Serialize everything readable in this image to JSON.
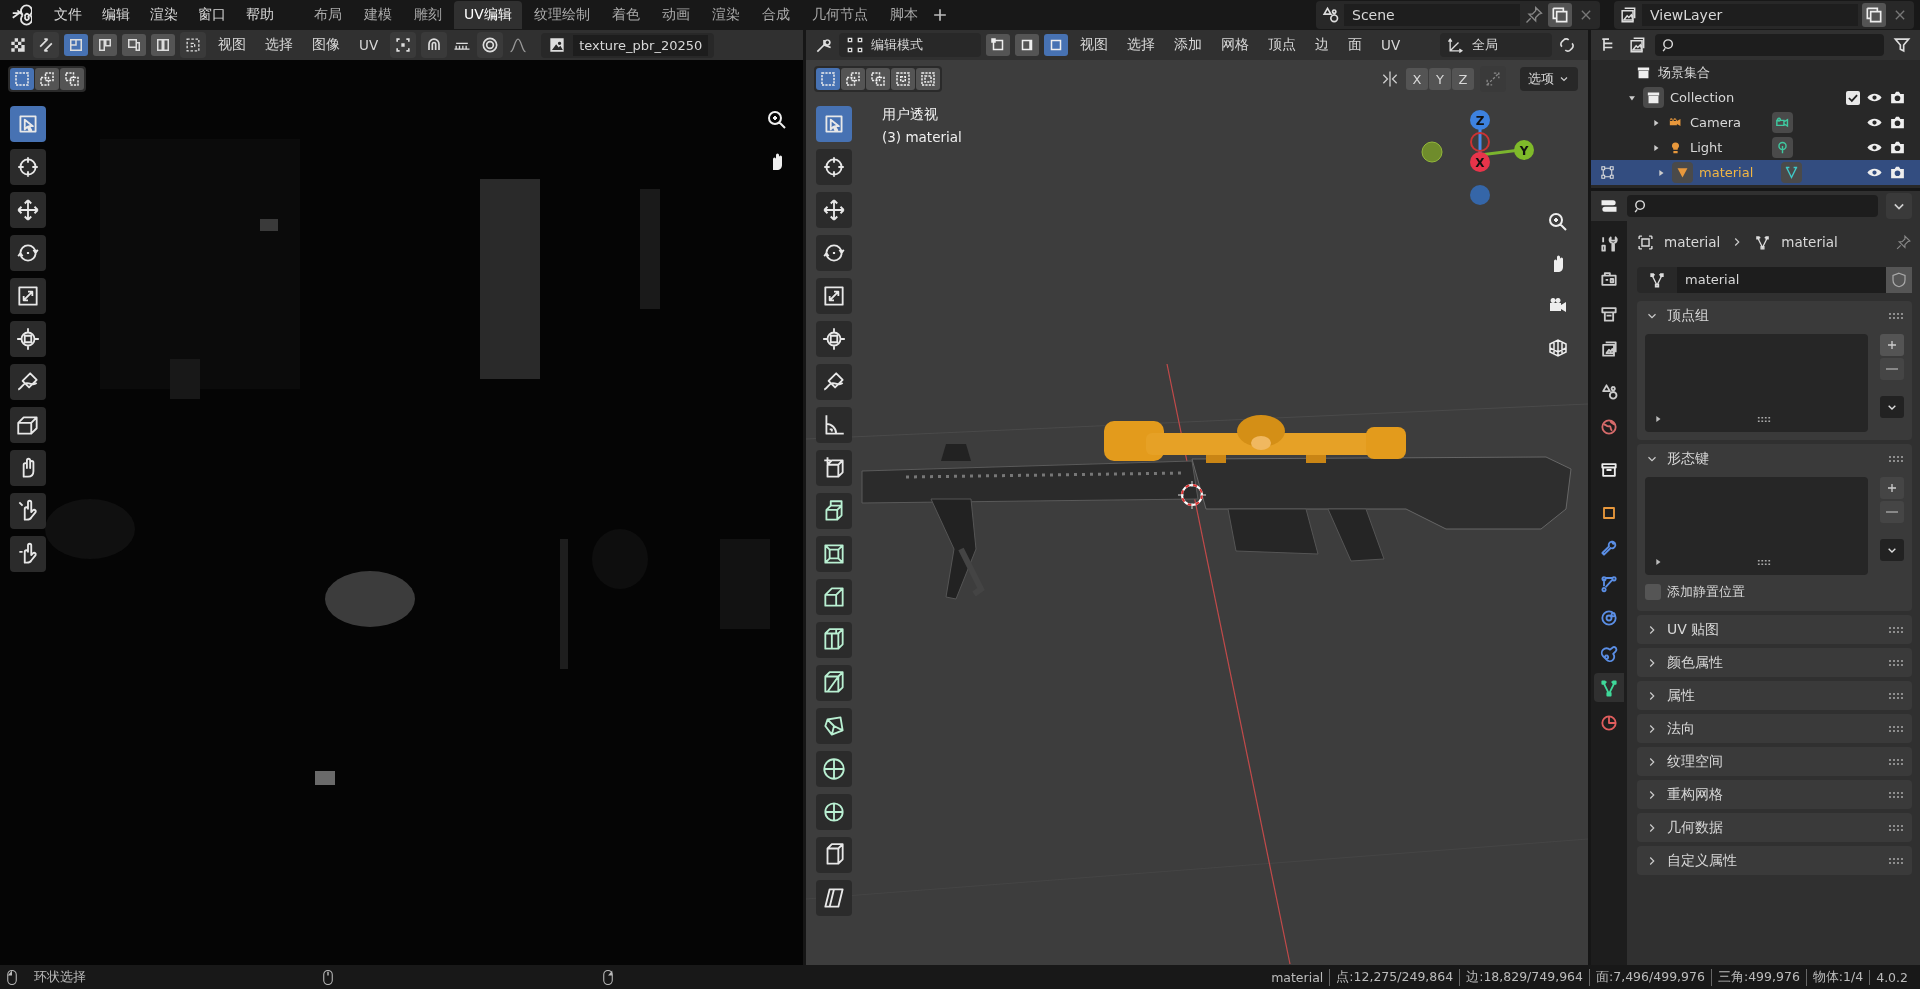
{
  "menu": [
    "文件",
    "编辑",
    "渲染",
    "窗口",
    "帮助"
  ],
  "workspaces": [
    {
      "label": "布局",
      "selected": false
    },
    {
      "label": "建模",
      "selected": false
    },
    {
      "label": "雕刻",
      "selected": false
    },
    {
      "label": "UV编辑",
      "selected": true
    },
    {
      "label": "纹理绘制",
      "selected": false
    },
    {
      "label": "着色",
      "selected": false
    },
    {
      "label": "动画",
      "selected": false
    },
    {
      "label": "渲染",
      "selected": false
    },
    {
      "label": "合成",
      "selected": false
    },
    {
      "label": "几何节点",
      "selected": false
    },
    {
      "label": "脚本",
      "selected": false
    }
  ],
  "scene": "Scene",
  "view_layer": "ViewLayer",
  "uv_editor": {
    "island_modes": [
      {
        "selected": true
      },
      {
        "selected": false
      },
      {
        "selected": false
      },
      {
        "selected": false
      }
    ],
    "menus": [
      "视图",
      "选择",
      "图像",
      "UV"
    ],
    "image": "texture_pbr_20250",
    "select_modes": [
      {
        "selected": true
      },
      {
        "selected": false
      },
      {
        "selected": false
      }
    ],
    "tools": [
      {
        "kind": "select",
        "selected": true
      },
      {
        "kind": "cursor",
        "selected": false
      },
      {
        "kind": "move",
        "selected": false
      },
      {
        "kind": "rotate",
        "selected": false
      },
      {
        "kind": "scale",
        "selected": false
      },
      {
        "kind": "transform",
        "selected": false
      },
      {
        "kind": "annotate",
        "selected": false
      },
      {
        "kind": "rip",
        "selected": false
      },
      {
        "kind": "grab",
        "selected": false
      },
      {
        "kind": "relax",
        "selected": false
      },
      {
        "kind": "pinch",
        "selected": false
      }
    ]
  },
  "viewport": {
    "mode": "编辑模式",
    "mesh_select_modes": [
      {
        "selected": false
      },
      {
        "selected": false
      },
      {
        "selected": true
      }
    ],
    "menus": [
      "视图",
      "选择",
      "添加",
      "网格",
      "顶点",
      "边",
      "面",
      "UV"
    ],
    "orientation": "全局",
    "select_modes": [
      {
        "selected": true
      },
      {
        "selected": false
      },
      {
        "selected": false
      },
      {
        "selected": false
      },
      {
        "selected": false
      }
    ],
    "mirror_axes": [
      "X",
      "Y",
      "Z"
    ],
    "options": "选项",
    "view_name": "用户透视",
    "object_info": "(3) material",
    "gizmo": [
      "Z",
      "X",
      "Y"
    ],
    "tools": [
      {
        "kind": "select",
        "selected": true
      },
      {
        "kind": "cursor",
        "selected": false
      },
      {
        "kind": "move",
        "selected": false
      },
      {
        "kind": "rotate",
        "selected": false
      },
      {
        "kind": "scale",
        "selected": false
      },
      {
        "kind": "transform",
        "selected": false
      },
      {
        "kind": "annotate",
        "selected": false
      },
      {
        "kind": "measure",
        "selected": false
      },
      {
        "kind": "add-cube",
        "selected": false
      },
      {
        "kind": "extrude",
        "selected": false
      },
      {
        "kind": "inset",
        "selected": false
      },
      {
        "kind": "bevel",
        "selected": false
      },
      {
        "kind": "loop-cut",
        "selected": false
      },
      {
        "kind": "knife",
        "selected": false
      },
      {
        "kind": "poly-build",
        "selected": false
      },
      {
        "kind": "spin",
        "selected": false
      },
      {
        "kind": "smooth",
        "selected": false
      },
      {
        "kind": "shrink",
        "selected": false
      },
      {
        "kind": "shear",
        "selected": false
      }
    ]
  },
  "outliner": {
    "root": "场景集合",
    "items": [
      {
        "name": "Collection",
        "kind": "collection",
        "expanded": true,
        "checked": true,
        "children": [
          {
            "name": "Camera",
            "kind": "camera",
            "selected": false
          },
          {
            "name": "Light",
            "kind": "light",
            "selected": false
          },
          {
            "name": "material",
            "kind": "mesh",
            "selected": true
          }
        ]
      }
    ]
  },
  "properties": {
    "tabs": [
      {
        "kind": "tool",
        "selected": false
      },
      {
        "kind": "render",
        "selected": false
      },
      {
        "kind": "output",
        "selected": false
      },
      {
        "kind": "view-layer",
        "selected": false
      },
      {
        "kind": "scene",
        "selected": false
      },
      {
        "kind": "world",
        "selected": false
      },
      {
        "kind": "collection",
        "selected": false
      },
      {
        "kind": "object",
        "selected": false
      },
      {
        "kind": "modifier",
        "selected": false
      },
      {
        "kind": "particles",
        "selected": false
      },
      {
        "kind": "physics",
        "selected": false
      },
      {
        "kind": "constraints",
        "selected": false
      },
      {
        "kind": "data",
        "selected": true
      },
      {
        "kind": "material",
        "selected": false
      }
    ],
    "object": "material",
    "data": "material",
    "data_name": "material",
    "panels": [
      {
        "label": "顶点组",
        "expanded": true
      },
      {
        "label": "形态键",
        "expanded": true,
        "option": {
          "label": "添加静置位置",
          "checked": false
        }
      },
      {
        "label": "UV 贴图",
        "expanded": false
      },
      {
        "label": "颜色属性",
        "expanded": false
      },
      {
        "label": "属性",
        "expanded": false
      },
      {
        "label": "法向",
        "expanded": false
      },
      {
        "label": "纹理空间",
        "expanded": false
      },
      {
        "label": "重构网格",
        "expanded": false
      },
      {
        "label": "几何数据",
        "expanded": false
      },
      {
        "label": "自定义属性",
        "expanded": false
      }
    ]
  },
  "status": {
    "hint": "环状选择",
    "stats": [
      "material",
      "点:12,275/249,864",
      "边:18,829/749,964",
      "面:7,496/499,976",
      "三角:499,976",
      "物体:1/4",
      "4.0.2"
    ]
  }
}
